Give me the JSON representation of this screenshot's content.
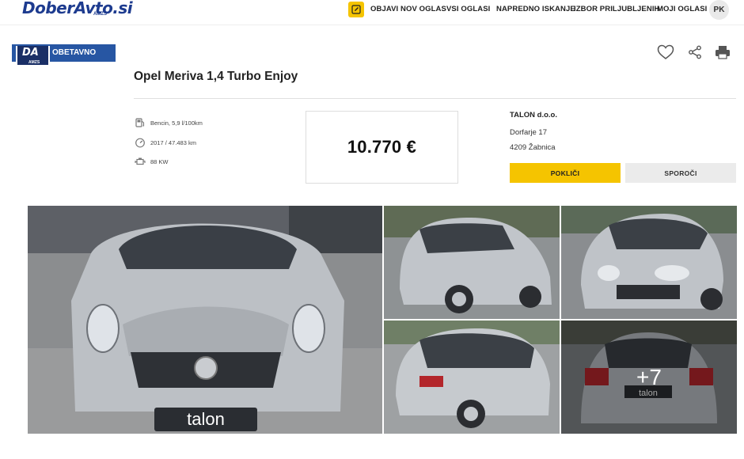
{
  "header": {
    "logo": "DoberAvto.si",
    "logo_sub": "AMZS",
    "nav": [
      "OBJAVI NOV OGLAS",
      "VSI OGLASI",
      "NAPREDNO ISKANJE",
      "IZBOR PRILJUBLJENIH",
      "MOJI OGLASI"
    ],
    "avatar": "PK"
  },
  "badge": {
    "mark": "DA",
    "mark_sub": "AMZS",
    "label": "OBETAVNO"
  },
  "listing": {
    "title": "Opel Meriva 1,4 Turbo Enjoy",
    "specs": [
      "Bencin, 5,9 l/100km",
      "2017 / 47.483 km",
      "88 KW"
    ],
    "price": "10.770 €"
  },
  "seller": {
    "name": "TALON d.o.o.",
    "street": "Dorfarje 17",
    "city": "4209 Žabnica",
    "call_label": "POKLIČI",
    "message_label": "SPOROČI"
  },
  "gallery": {
    "more_count": "+7",
    "plate_text": "talon"
  },
  "colors": {
    "accent": "#f5c400",
    "brand_blue": "#2756a3",
    "car_silver": "#bfc3c8"
  },
  "icons": [
    "edit-icon",
    "heart-icon",
    "share-icon",
    "print-icon",
    "fuel-icon",
    "speedometer-icon",
    "engine-icon"
  ]
}
